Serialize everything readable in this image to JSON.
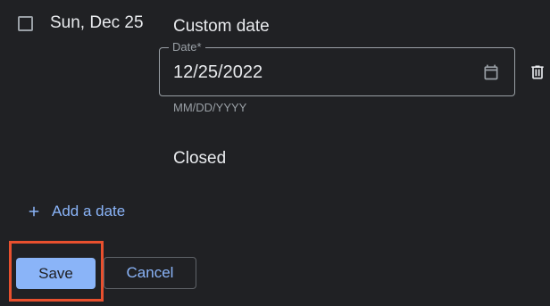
{
  "row": {
    "day_label": "Sun, Dec 25",
    "checked": false,
    "custom_date_label": "Custom date",
    "date_field": {
      "label": "Date*",
      "value": "12/25/2022",
      "helper": "MM/DD/YYYY"
    },
    "status_label": "Closed"
  },
  "add_date": {
    "label": "Add a date"
  },
  "actions": {
    "save_label": "Save",
    "cancel_label": "Cancel"
  },
  "icons": {
    "calendar": "calendar-icon",
    "trash": "trash-icon",
    "plus": "plus-icon",
    "checkbox": "checkbox-empty"
  },
  "colors": {
    "background": "#202124",
    "text": "#e8eaed",
    "muted": "#9aa0a6",
    "accent": "#8ab4f8",
    "highlight": "#e8502e"
  }
}
